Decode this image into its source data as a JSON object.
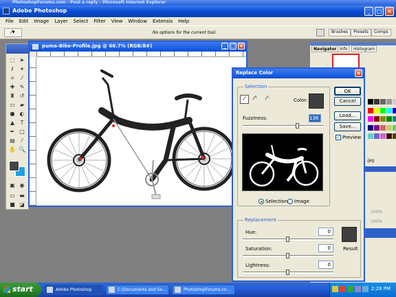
{
  "background_window": {
    "title": "PhotoshopForums.com - Post a reply - Microsoft Internet Explorer"
  },
  "app": {
    "title": "Adobe Photoshop"
  },
  "menu": [
    "File",
    "Edit",
    "Image",
    "Layer",
    "Select",
    "Filter",
    "View",
    "Window",
    "Extensis",
    "Help"
  ],
  "options_bar": {
    "message": "No options for the current tool.",
    "tool_icon": "eyedropper-icon"
  },
  "palette_well": {
    "tabs": [
      "Brushes",
      "Presets",
      "Comps"
    ]
  },
  "document": {
    "title": "puma-Bike-Profile.jpg @ 66.7% (RGB/8#)"
  },
  "right_panel": {
    "tabs": [
      "Navigator",
      "Info",
      "Histogram"
    ],
    "side_labels": [
      ".jpg",
      "100%",
      "100%"
    ]
  },
  "dialog": {
    "title": "Replace Color",
    "selection_group": "Selection",
    "color_label": "Color:",
    "fuzziness_label": "Fuzziness:",
    "fuzziness_value": "136",
    "fuzziness_fraction": 0.68,
    "radio_selection": "Selection",
    "radio_image": "Image",
    "radio_selected": "Selection",
    "replacement_group": "Replacement",
    "hue_label": "Hue:",
    "hue_value": "0",
    "saturation_label": "Saturation:",
    "saturation_value": "0",
    "lightness_label": "Lightness:",
    "lightness_value": "0",
    "result_label": "Result",
    "buttons": {
      "ok": "OK",
      "cancel": "Cancel",
      "load": "Load...",
      "save": "Save..."
    },
    "preview_label": "Preview",
    "preview_checked": true,
    "sample_color": "#3f3f3f",
    "result_color": "#3f3f3f"
  },
  "taskbar": {
    "start": "start",
    "tasks": [
      "Adobe Photoshop",
      "C:\\Documents and Se...",
      "PhotoshopForums.co..."
    ],
    "clock": "2:28 PM"
  }
}
